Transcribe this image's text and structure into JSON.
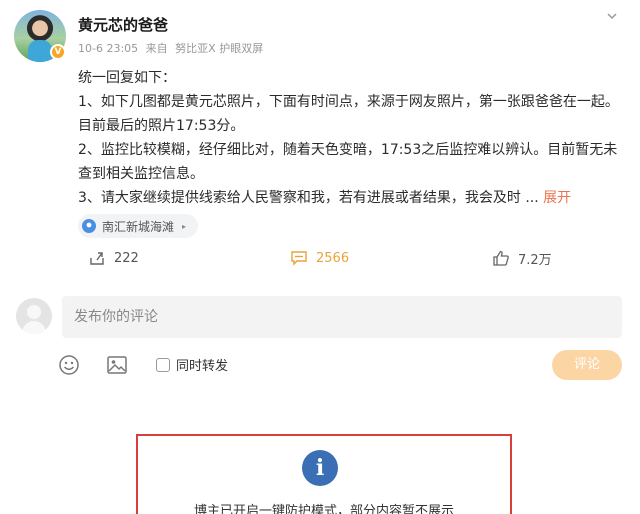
{
  "user": {
    "name": "黄元芯的爸爸",
    "badge": "V",
    "timestamp": "10-6 23:05",
    "source_prefix": "来自",
    "device": "努比亚X 护眼双屏"
  },
  "post": {
    "lines": [
      "统一回复如下：",
      "1、如下几图都是黄元芯照片，下面有时间点，来源于网友照片，第一张跟爸爸在一起。目前最后的照片17:53分。",
      "2、监控比较模糊，经仔细比对，随着天色变暗，17:53之后监控难以辨认。目前暂无未查到相关监控信息。",
      "3、请大家继续提供线索给人民警察和我，若有进展或者结果，我会及时 ..."
    ],
    "expand_label": "展开"
  },
  "location": {
    "name": "南汇新城海滩",
    "arrow": "▸"
  },
  "actions": {
    "repost_count": "222",
    "comment_count": "2566",
    "like_count": "7.2万"
  },
  "comment_box": {
    "placeholder": "发布你的评论",
    "repost_option": "同时转发",
    "submit_label": "评论"
  },
  "notice": {
    "icon_glyph": "i",
    "text": "博主已开启一键防护模式，部分内容暂不展示"
  },
  "colors": {
    "accent": "#eb7350",
    "comment_active": "#e8a43a",
    "submit_disabled": "#fbd6a4",
    "notice_border": "#d7403a",
    "info_blue": "#3a6fb5"
  }
}
